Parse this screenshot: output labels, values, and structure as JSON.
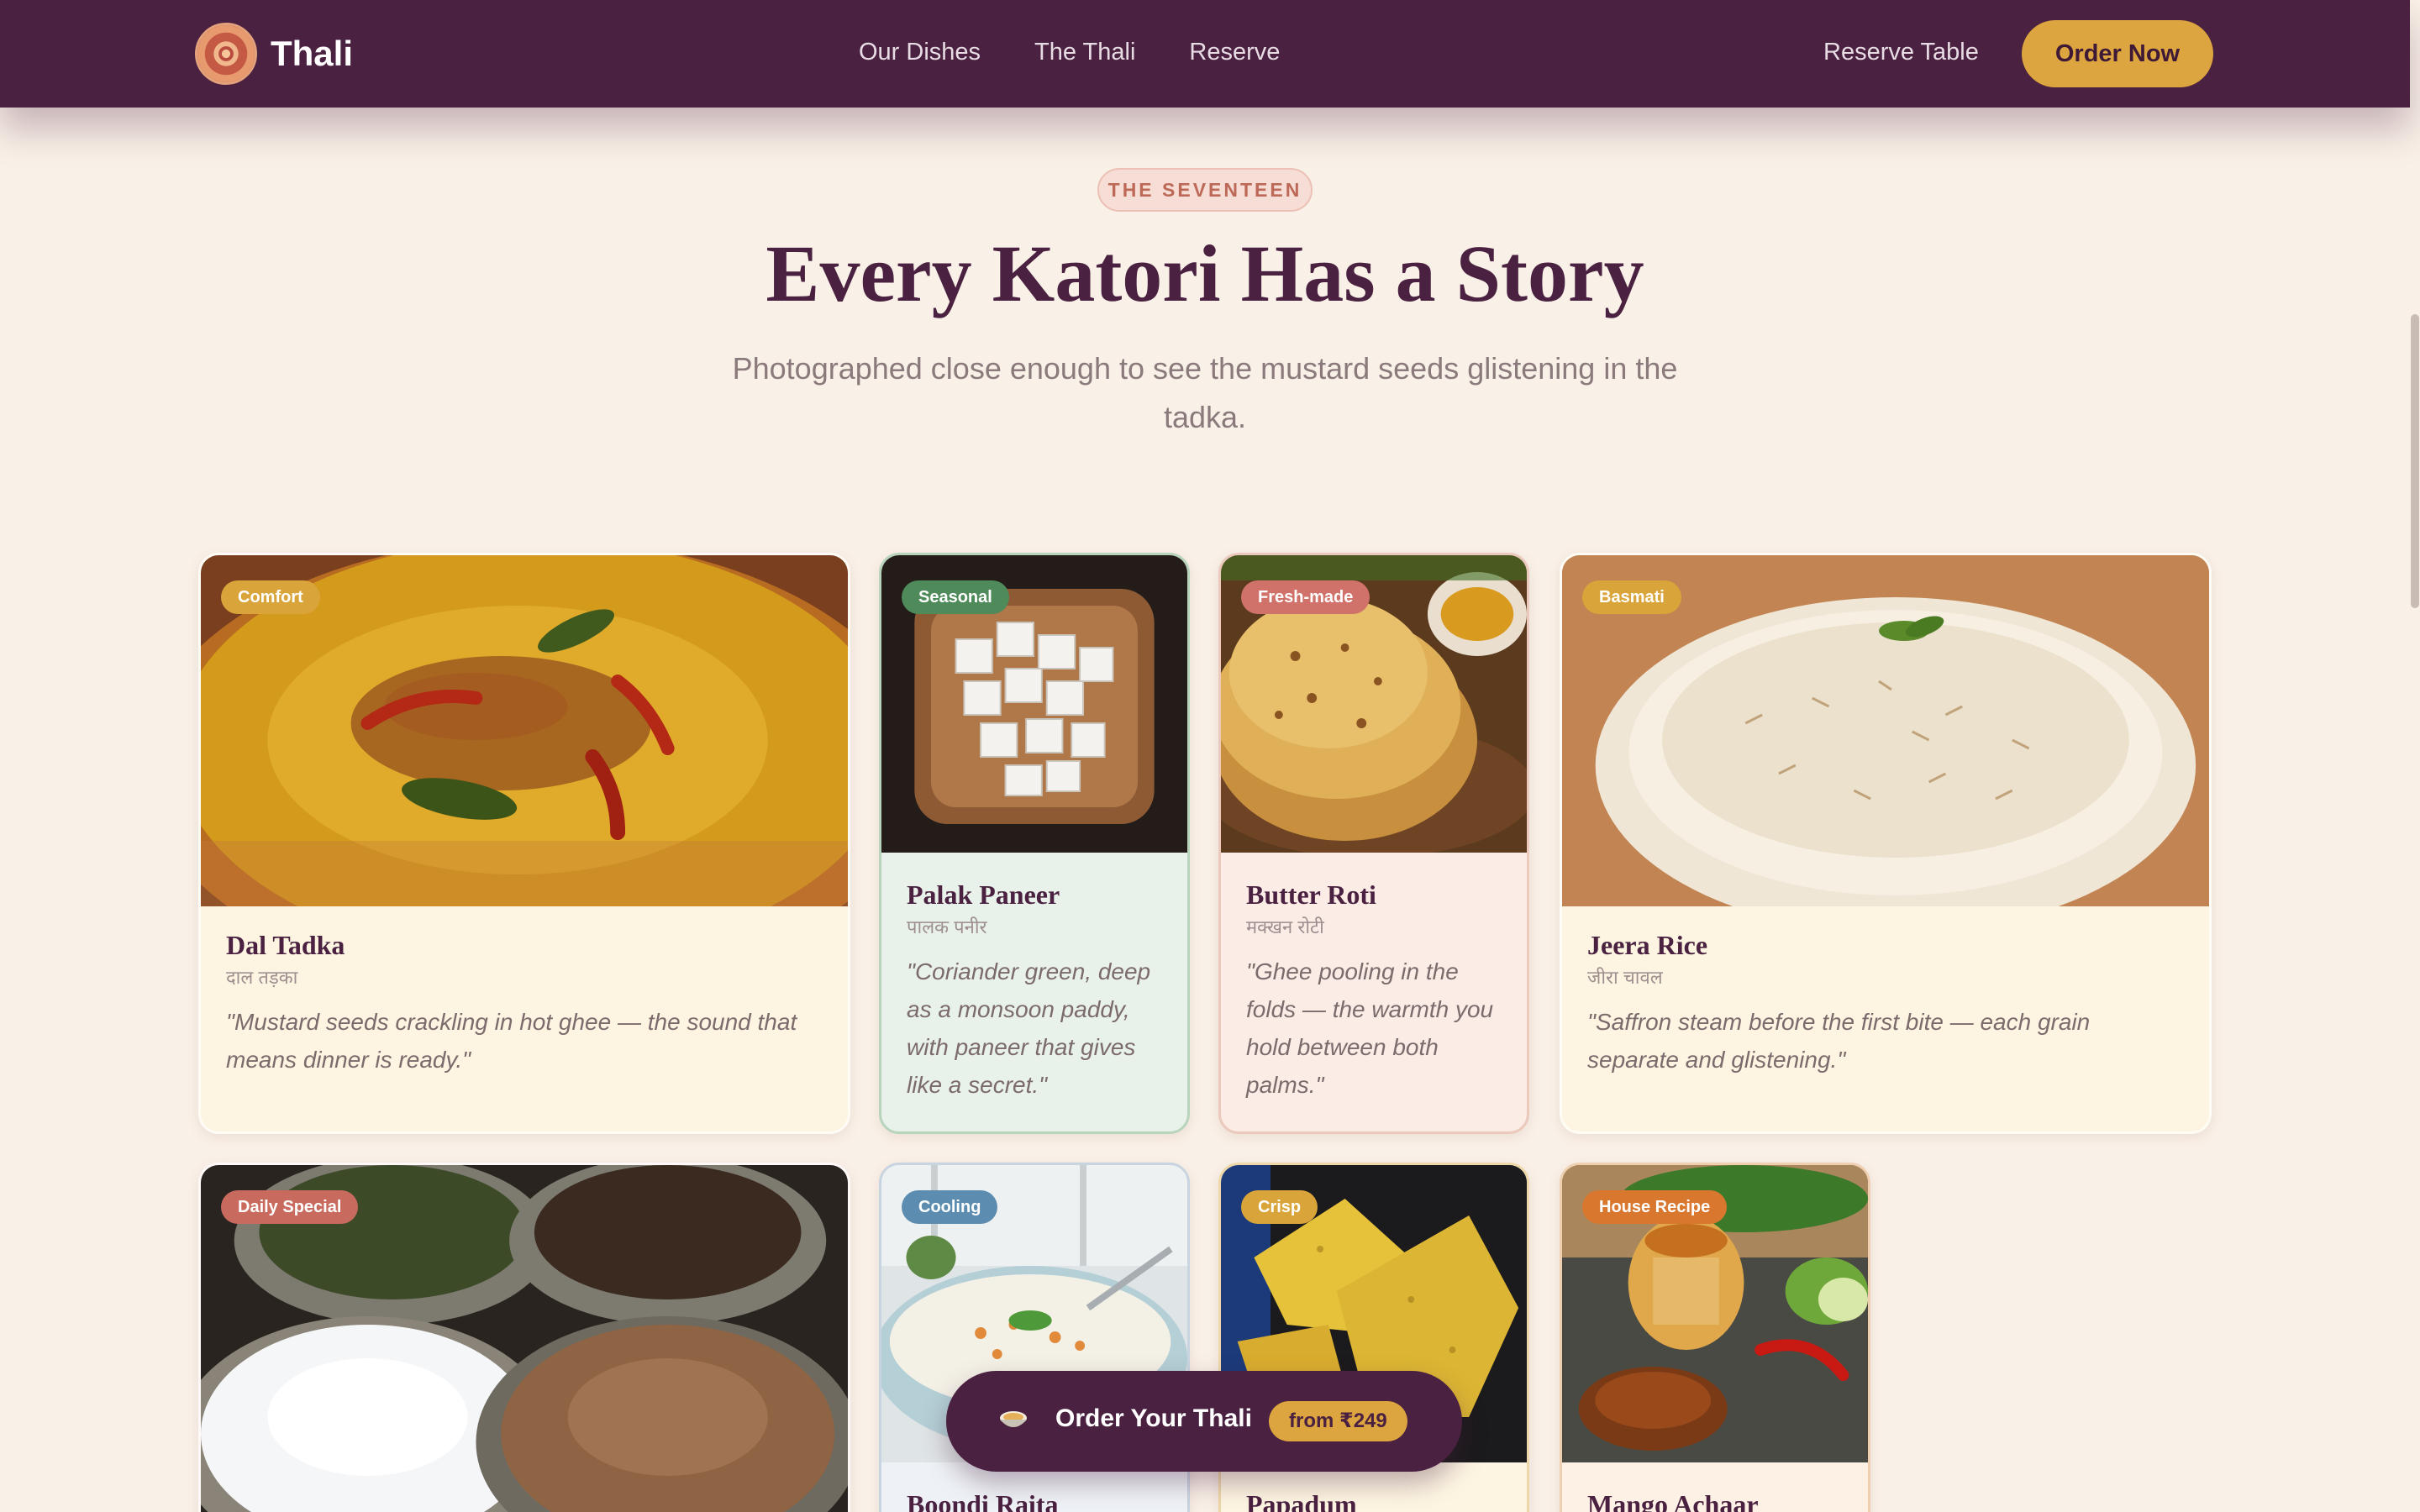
{
  "nav": {
    "brand": "Thali",
    "links": [
      "Our Dishes",
      "The Thali",
      "Reserve"
    ],
    "reserve_table": "Reserve Table",
    "order_now": "Order Now"
  },
  "hero": {
    "eyebrow": "THE SEVENTEEN",
    "title": "Every Katori Has a Story",
    "subtitle": "Photographed close enough to see the mustard seeds glistening in the tadka."
  },
  "dishes": [
    {
      "badge": "Comfort",
      "badge_color": "#d9a53a",
      "name": "Dal Tadka",
      "hindi": "दाल तड़का",
      "quote": "\"Mustard seeds crackling in hot ghee — the sound that means dinner is ready.\"",
      "bg": "#fdf5e2"
    },
    {
      "badge": "Seasonal",
      "badge_color": "#4e8a5a",
      "name": "Palak Paneer",
      "hindi": "पालक पनीर",
      "quote": "\"Coriander green, deep as a monsoon paddy, with paneer that gives like a secret.\"",
      "bg": "#e9f2ea"
    },
    {
      "badge": "Fresh-made",
      "badge_color": "#d0716a",
      "name": "Butter Roti",
      "hindi": "मक्खन रोटी",
      "quote": "\"Ghee pooling in the folds — the warmth you hold between both palms.\"",
      "bg": "#fbece6"
    },
    {
      "badge": "Basmati",
      "badge_color": "#d9a53a",
      "name": "Jeera Rice",
      "hindi": "जीरा चावल",
      "quote": "\"Saffron steam before the first bite — each grain separate and glistening.\"",
      "bg": "#fdf5e2"
    },
    {
      "badge": "Daily Special",
      "badge_color": "#c86a5d",
      "name": "",
      "hindi": "",
      "quote": "",
      "bg": "#fbece6"
    },
    {
      "badge": "Cooling",
      "badge_color": "#5c8db0",
      "name": "Boondi Raita",
      "hindi": "",
      "quote": "",
      "bg": "#eef2f6"
    },
    {
      "badge": "Crisp",
      "badge_color": "#d9a53a",
      "name": "Papadum",
      "hindi": "",
      "quote": "",
      "bg": "#fdf5e2"
    },
    {
      "badge": "House Recipe",
      "badge_color": "#d9772f",
      "name": "Mango Achaar",
      "hindi": "",
      "quote": "",
      "bg": "#fdf0e4"
    }
  ],
  "cta": {
    "label": "Order Your Thali",
    "price": "from ₹249"
  }
}
